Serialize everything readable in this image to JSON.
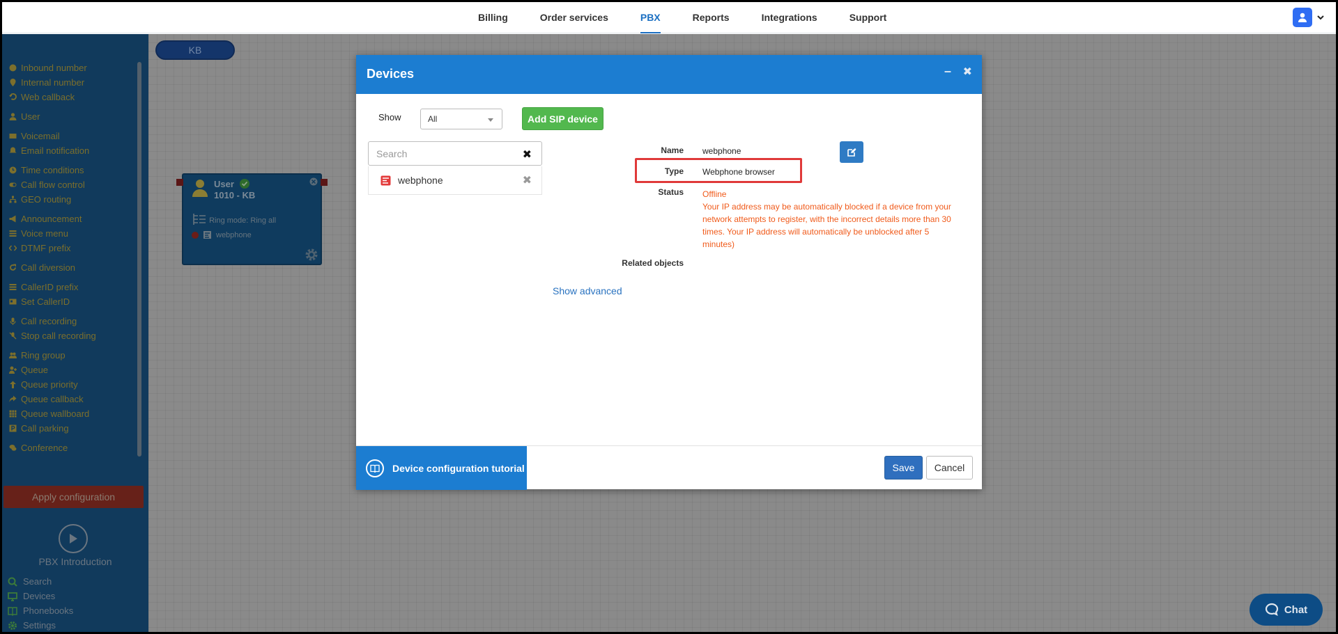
{
  "nav": {
    "items": [
      {
        "label": "Billing",
        "active": false
      },
      {
        "label": "Order services",
        "active": false
      },
      {
        "label": "PBX",
        "active": true
      },
      {
        "label": "Reports",
        "active": false
      },
      {
        "label": "Integrations",
        "active": false
      },
      {
        "label": "Support",
        "active": false
      }
    ],
    "accent_color": "#1b6fc2"
  },
  "sidebar": {
    "groups": [
      [
        {
          "label": "Inbound number",
          "icon": "phone-icon"
        },
        {
          "label": "Internal number",
          "icon": "pin-icon"
        },
        {
          "label": "Web callback",
          "icon": "callback-icon"
        }
      ],
      [
        {
          "label": "User",
          "icon": "user-icon"
        }
      ],
      [
        {
          "label": "Voicemail",
          "icon": "mail-icon"
        },
        {
          "label": "Email notification",
          "icon": "bell-icon"
        }
      ],
      [
        {
          "label": "Time conditions",
          "icon": "clock-icon"
        },
        {
          "label": "Call flow control",
          "icon": "toggle-icon"
        },
        {
          "label": "GEO routing",
          "icon": "sitemap-icon"
        }
      ],
      [
        {
          "label": "Announcement",
          "icon": "megaphone-icon"
        },
        {
          "label": "Voice menu",
          "icon": "list-icon"
        },
        {
          "label": "DTMF prefix",
          "icon": "code-icon"
        }
      ],
      [
        {
          "label": "Call diversion",
          "icon": "refresh-icon"
        }
      ],
      [
        {
          "label": "CallerID prefix",
          "icon": "list-icon"
        },
        {
          "label": "Set CallerID",
          "icon": "id-card-icon"
        }
      ],
      [
        {
          "label": "Call recording",
          "icon": "microphone-icon"
        },
        {
          "label": "Stop call recording",
          "icon": "microphone-slash-icon"
        }
      ],
      [
        {
          "label": "Ring group",
          "icon": "users-icon"
        },
        {
          "label": "Queue",
          "icon": "user-plus-icon"
        },
        {
          "label": "Queue priority",
          "icon": "arrow-up-icon"
        },
        {
          "label": "Queue callback",
          "icon": "share-icon"
        },
        {
          "label": "Queue wallboard",
          "icon": "table-icon"
        },
        {
          "label": "Call parking",
          "icon": "parking-icon"
        }
      ],
      [
        {
          "label": "Conference",
          "icon": "comments-icon"
        }
      ]
    ],
    "apply_label": "Apply configuration",
    "intro_label": "PBX Introduction",
    "bottom": [
      {
        "label": "Search",
        "icon": "search-icon"
      },
      {
        "label": "Devices",
        "icon": "monitor-icon"
      },
      {
        "label": "Phonebooks",
        "icon": "book-icon"
      },
      {
        "label": "Settings",
        "icon": "gear-icon"
      }
    ]
  },
  "canvas": {
    "pill_label": "KB",
    "node": {
      "title": "User",
      "subtitle": "1010 - KB",
      "ring_mode": "Ring mode: Ring all",
      "device": "webphone"
    }
  },
  "modal": {
    "title": "Devices",
    "show_label": "Show",
    "show_value": "All",
    "add_sip_label": "Add SIP device",
    "search_placeholder": "Search",
    "devices": [
      "webphone"
    ],
    "fields": {
      "name_label": "Name",
      "name_value": "webphone",
      "type_label": "Type",
      "type_value": "Webphone browser",
      "status_label": "Status",
      "status_value": "Offline",
      "status_note": "Your IP address may be automatically blocked if a device from your network attempts to register, with the incorrect details more than 30 times. Your IP address will automatically be unblocked after 5 minutes)",
      "related_label": "Related objects"
    },
    "show_advanced": "Show advanced",
    "tutorial_label": "Device configuration tutorial",
    "save_label": "Save",
    "cancel_label": "Cancel"
  },
  "chat": {
    "label": "Chat"
  }
}
